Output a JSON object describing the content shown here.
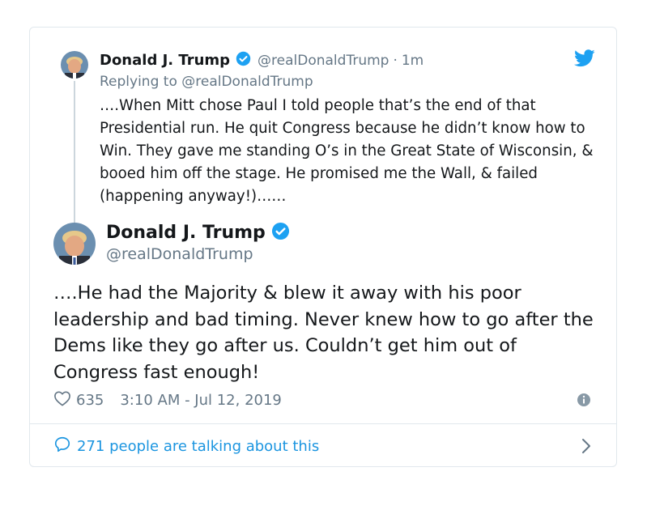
{
  "colors": {
    "accent": "#1b95e0",
    "verified": "#1da1f2",
    "secondary_text": "#657786",
    "primary_text": "#14171a",
    "border": "#e1e8ed"
  },
  "parent_tweet": {
    "name": "Donald J. Trump",
    "handle": "@realDonaldTrump",
    "separator": "·",
    "time": "1m",
    "replying_prefix": "Replying to",
    "replying_to": "@realDonaldTrump",
    "text": "….When Mitt chose Paul I told people that’s the end of that Presidential run. He quit Congress because he didn’t know how to Win. They gave me standing O’s in the Great State of Wisconsin, & booed him off the stage. He promised me the Wall, & failed (happening anyway!)……"
  },
  "main_tweet": {
    "name": "Donald J. Trump",
    "handle": "@realDonaldTrump",
    "text": "….He had the Majority & blew it away with his poor leadership and bad timing. Never knew how to go after the Dems like they go after us. Couldn’t get him out of Congress fast enough!",
    "like_count": "635",
    "timestamp": "3:10 AM - Jul 12, 2019"
  },
  "footer": {
    "talking_text": "271 people are talking about this"
  },
  "icons": {
    "bird": "twitter-bird-icon",
    "verified": "verified-badge-icon",
    "like": "heart-icon",
    "info": "info-icon",
    "talk": "speech-bubble-icon",
    "chevron": "chevron-right-icon"
  }
}
